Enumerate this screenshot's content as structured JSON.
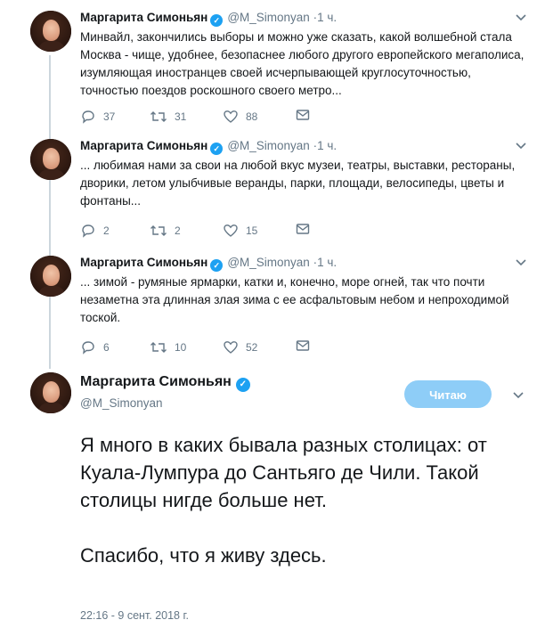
{
  "author": {
    "name": "Маргарита Симоньян",
    "handle": "@M_Simonyan"
  },
  "thread": [
    {
      "time": "1 ч.",
      "text": "Минвайл, закончились выборы и можно уже сказать, какой волшебной стала Москва - чище, удобнее, безопаснее любого другого европейского мегаполиса, изумляющая иностранцев своей исчерпывающей круглосуточностью, точностью поездов роскошного своего метро...",
      "replies": "37",
      "retweets": "31",
      "likes": "88"
    },
    {
      "time": "1 ч.",
      "text": "... любимая нами за свои на любой вкус музеи, театры, выставки,  рестораны, дворики, летом улыбчивые веранды, парки, площади, велосипеды, цветы и фонтаны...",
      "replies": "2",
      "retweets": "2",
      "likes": "15"
    },
    {
      "time": "1 ч.",
      "text": "... зимой - румяные ярмарки, катки и, конечно, море огней, так что почти незаметна эта длинная злая зима с ее асфальтовым небом и непроходимой тоской.",
      "replies": "6",
      "retweets": "10",
      "likes": "52"
    }
  ],
  "main_tweet": {
    "follow_label": "Читаю",
    "text": "Я много в каких бывала разных столицах: от Куала-Лумпура до Сантьяго де Чили. Такой столицы нигде больше нет.\n\nСпасибо, что я живу здесь.",
    "date": "22:16 - 9 сент. 2018 г."
  },
  "colors": {
    "accent": "#1da1f2",
    "follow_button": "#8ecdf7",
    "secondary_text": "#657786",
    "thread_line": "#ccd6dd"
  },
  "icons": [
    "reply-icon",
    "retweet-icon",
    "like-icon",
    "message-icon",
    "verified-badge-icon",
    "chevron-down-icon"
  ]
}
